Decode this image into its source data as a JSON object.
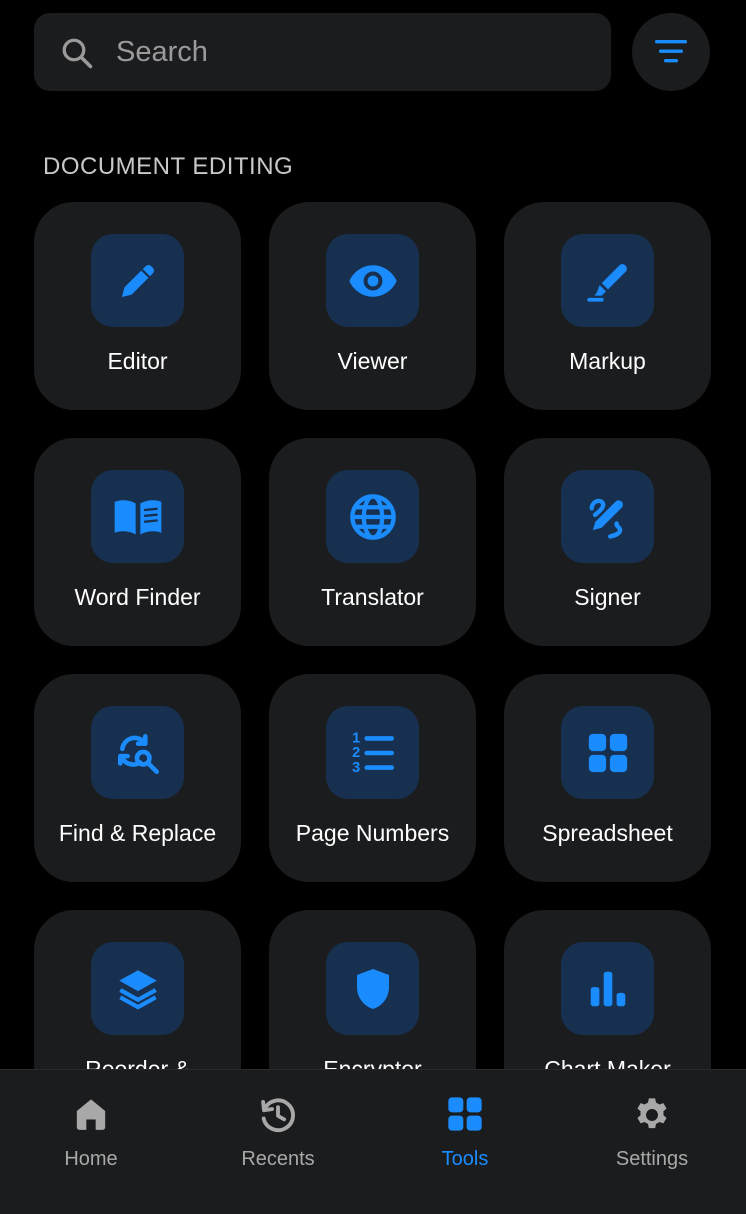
{
  "search": {
    "placeholder": "Search",
    "value": ""
  },
  "colors": {
    "accent": "#1a8cff",
    "tile_bg": "#18304f",
    "card_bg": "#1b1c1e",
    "background": "#000000"
  },
  "section": {
    "title": "DOCUMENT EDITING"
  },
  "tools": [
    {
      "label": "Editor",
      "icon": "pencil-icon"
    },
    {
      "label": "Viewer",
      "icon": "eye-icon"
    },
    {
      "label": "Markup",
      "icon": "highlighter-icon"
    },
    {
      "label": "Word Finder",
      "icon": "book-icon"
    },
    {
      "label": "Translator",
      "icon": "globe-icon"
    },
    {
      "label": "Signer",
      "icon": "signature-icon"
    },
    {
      "label": "Find & Replace",
      "icon": "find-replace-icon"
    },
    {
      "label": "Page Numbers",
      "icon": "numbered-list-icon"
    },
    {
      "label": "Spreadsheet",
      "icon": "grid-icon"
    },
    {
      "label": "Reorder &",
      "icon": "layers-icon"
    },
    {
      "label": "Encryptor",
      "icon": "shield-icon"
    },
    {
      "label": "Chart Maker",
      "icon": "bar-chart-icon"
    }
  ],
  "nav": [
    {
      "label": "Home",
      "icon": "home-icon",
      "active": false
    },
    {
      "label": "Recents",
      "icon": "history-icon",
      "active": false
    },
    {
      "label": "Tools",
      "icon": "grid-icon",
      "active": true
    },
    {
      "label": "Settings",
      "icon": "gear-icon",
      "active": false
    }
  ]
}
